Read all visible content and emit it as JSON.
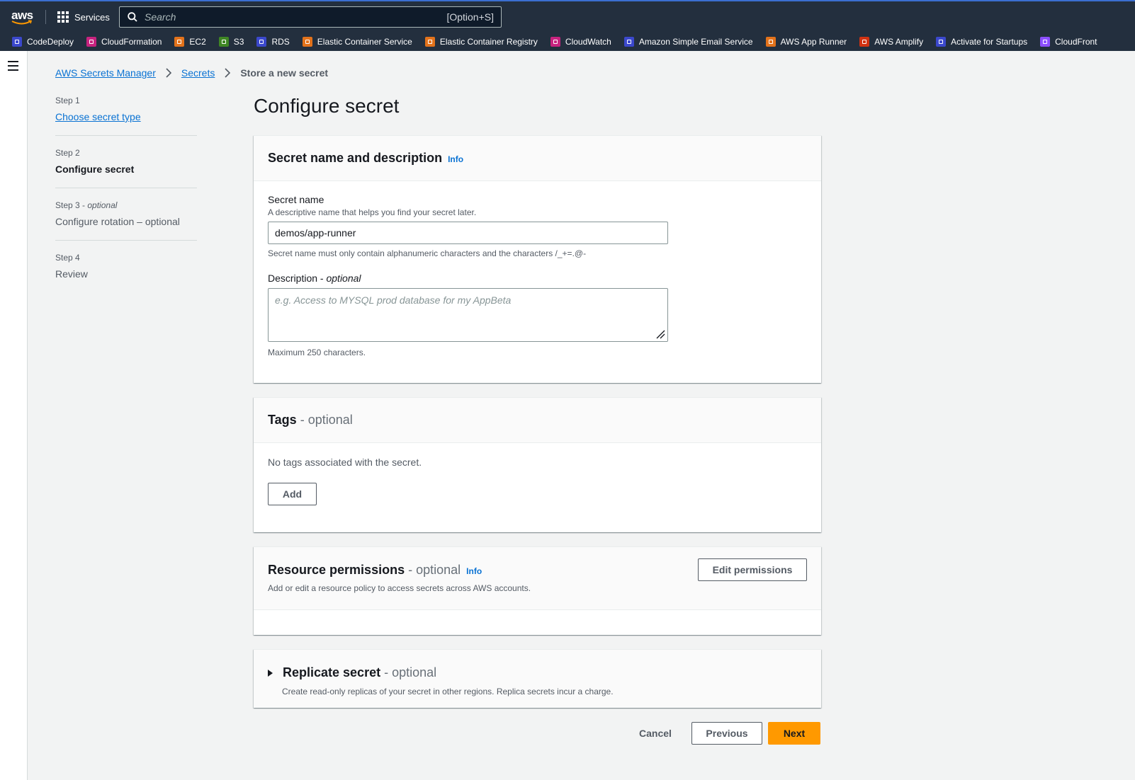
{
  "nav": {
    "logo": "aws",
    "services_label": "Services",
    "search_placeholder": "Search",
    "search_shortcut": "[Option+S]",
    "favorites": [
      {
        "label": "CodeDeploy",
        "color": "#3b48cc"
      },
      {
        "label": "CloudFormation",
        "color": "#c7237f"
      },
      {
        "label": "EC2",
        "color": "#e2721b"
      },
      {
        "label": "S3",
        "color": "#3f8624"
      },
      {
        "label": "RDS",
        "color": "#3b48cc"
      },
      {
        "label": "Elastic Container Service",
        "color": "#e2721b"
      },
      {
        "label": "Elastic Container Registry",
        "color": "#e2721b"
      },
      {
        "label": "CloudWatch",
        "color": "#c7237f"
      },
      {
        "label": "Amazon Simple Email Service",
        "color": "#3b48cc"
      },
      {
        "label": "AWS App Runner",
        "color": "#e2721b"
      },
      {
        "label": "AWS Amplify",
        "color": "#d13212"
      },
      {
        "label": "Activate for Startups",
        "color": "#3b48cc"
      },
      {
        "label": "CloudFront",
        "color": "#8c4fff"
      }
    ]
  },
  "breadcrumb": {
    "root": "AWS Secrets Manager",
    "parent": "Secrets",
    "current": "Store a new secret"
  },
  "steps": [
    {
      "label": "Step 1",
      "title": "Choose secret type"
    },
    {
      "label": "Step 2",
      "title": "Configure secret"
    },
    {
      "label": "Step 3",
      "label_suffix": "optional",
      "title": "Configure rotation – optional"
    },
    {
      "label": "Step 4",
      "title": "Review"
    }
  ],
  "page_title": "Configure secret",
  "name_panel": {
    "title": "Secret name and description",
    "info": "Info",
    "secret_name_label": "Secret name",
    "secret_name_desc": "A descriptive name that helps you find your secret later.",
    "secret_name_value": "demos/app-runner",
    "secret_name_constraint": "Secret name must only contain alphanumeric characters and the characters /_+=.@-",
    "description_label": "Description",
    "description_optional": "optional",
    "description_placeholder": "e.g. Access to MYSQL prod database for my AppBeta",
    "description_constraint": "Maximum 250 characters."
  },
  "tags_panel": {
    "title": "Tags",
    "optional": "optional",
    "empty_text": "No tags associated with the secret.",
    "add_label": "Add"
  },
  "permissions_panel": {
    "title": "Resource permissions",
    "optional": "optional",
    "info": "Info",
    "desc": "Add or edit a resource policy to access secrets across AWS accounts.",
    "edit_label": "Edit permissions"
  },
  "replicate_panel": {
    "title": "Replicate secret",
    "optional": "optional",
    "desc": "Create read-only replicas of your secret in other regions. Replica secrets incur a charge."
  },
  "actions": {
    "cancel": "Cancel",
    "previous": "Previous",
    "next": "Next"
  }
}
